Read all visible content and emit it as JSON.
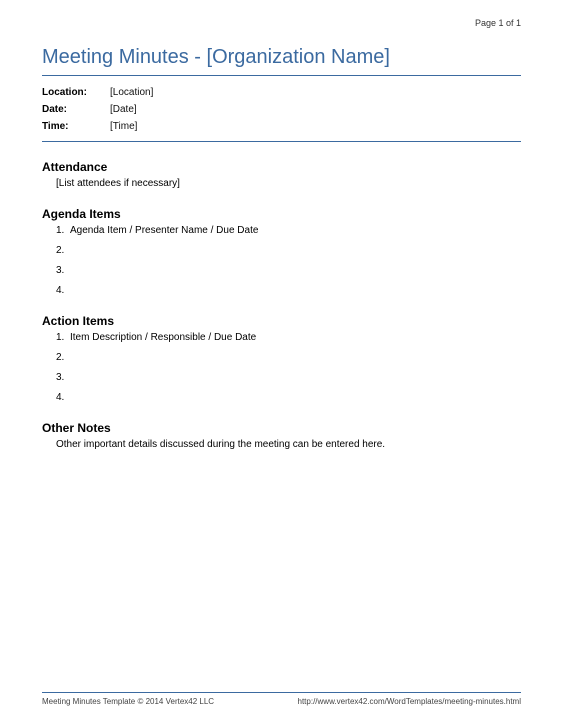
{
  "page_number": "Page 1 of 1",
  "title": "Meeting Minutes - [Organization Name]",
  "meta": {
    "location_label": "Location:",
    "location_value": "[Location]",
    "date_label": "Date:",
    "date_value": "[Date]",
    "time_label": "Time:",
    "time_value": "[Time]"
  },
  "attendance": {
    "heading": "Attendance",
    "body": "[List attendees if necessary]"
  },
  "agenda": {
    "heading": "Agenda Items",
    "items": [
      "Agenda Item / Presenter Name / Due Date",
      "",
      "",
      ""
    ]
  },
  "actions": {
    "heading": "Action Items",
    "items": [
      "Item Description / Responsible / Due Date",
      "",
      "",
      ""
    ]
  },
  "other": {
    "heading": "Other Notes",
    "body": "Other important details discussed during the meeting can be entered here."
  },
  "footer": {
    "left": "Meeting Minutes Template © 2014 Vertex42 LLC",
    "right": "http://www.vertex42.com/WordTemplates/meeting-minutes.html"
  }
}
